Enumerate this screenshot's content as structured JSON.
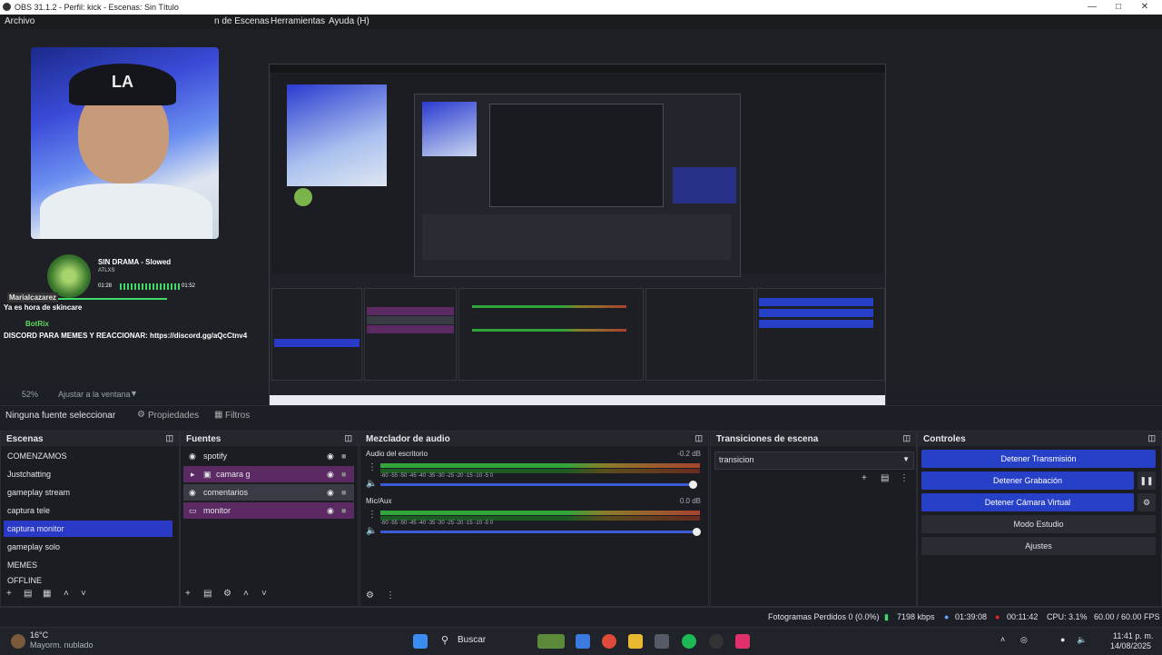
{
  "window": {
    "title": "OBS 31.1.2 - Perfil: kick - Escenas: Sin Título"
  },
  "menu": {
    "file": "Archivo",
    "scenes": "n de Escenas",
    "tools": "Herramientas",
    "help": "Ayuda (H)"
  },
  "overlay": {
    "song": "SIN DRAMA - Slowed",
    "artist": "ATLXS",
    "time_current": "01:28",
    "time_total": "01:52",
    "chat_user": "Marialcazarez",
    "chat_msg": "Ya es hora de skincare",
    "bot_name": "BotRix",
    "bot_msg": "DISCORD PARA MEMES Y REACCIONAR: https://discord.gg/aQcCtnv4"
  },
  "zoom": {
    "level": "52%",
    "mode": "Ajustar a la ventana"
  },
  "source_bar": {
    "none_selected": "Ninguna fuente seleccionar",
    "properties": "Propiedades",
    "filters": "Filtros"
  },
  "docks": {
    "scenes": "Escenas",
    "sources": "Fuentes",
    "mixer": "Mezclador de audio",
    "transitions": "Transiciones de escena",
    "controls": "Controles"
  },
  "scenes": [
    "COMENZAMOS",
    "Justchatting",
    "gameplay stream",
    "captura tele",
    "captura monitor",
    "gameplay solo",
    "MEMES",
    "OFFLINE"
  ],
  "sources": [
    "spotify",
    "camara g",
    "comentarios",
    "monitor"
  ],
  "mixer": {
    "track1_name": "Audio del escritorio",
    "track1_db": "-0.2 dB",
    "track2_name": "Mic/Aux",
    "track2_db": "0.0 dB",
    "ticks": "-60  -55  -50  -45  -40  -35  -30  -25  -20  -15  -10  -5  0"
  },
  "transitions": {
    "selected": "transicion"
  },
  "controls": {
    "stop_stream": "Detener Transmisión",
    "stop_record": "Detener Grabación",
    "stop_vcam": "Detener Cámara Virtual",
    "studio_mode": "Modo Estudio",
    "settings": "Ajustes"
  },
  "status": {
    "dropped": "Fotogramas Perdidos 0 (0.0%)",
    "bitrate": "7198 kbps",
    "stream_time": "01:39:08",
    "rec_time": "00:11:42",
    "cpu": "CPU: 3.1%",
    "fps": "60.00 / 60.00 FPS"
  },
  "taskbar": {
    "temp": "16°C",
    "weather": "Mayorm. nublado",
    "search": "Buscar",
    "time": "11:41 p. m.",
    "date": "14/08/2025"
  },
  "colors": {
    "accent": "#2740c8",
    "group": "#5b2a63",
    "rec": "#e0252b"
  }
}
